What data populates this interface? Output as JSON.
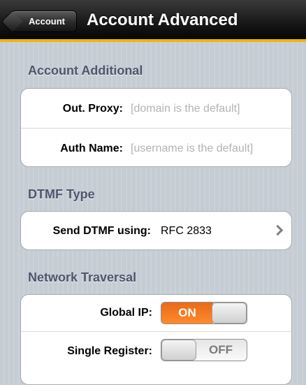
{
  "navbar": {
    "back_label": "Account",
    "title": "Account Advanced",
    "accent_color": "#f0b400"
  },
  "sections": {
    "account_additional": {
      "header": "Account Additional",
      "out_proxy": {
        "label": "Out. Proxy:",
        "placeholder": "[domain is the default]"
      },
      "auth_name": {
        "label": "Auth Name:",
        "placeholder": "[username is the default]"
      }
    },
    "dtmf_type": {
      "header": "DTMF Type",
      "send_dtmf": {
        "label": "Send DTMF using:",
        "value": "RFC 2833",
        "icon": "chevron-right-icon"
      }
    },
    "network_traversal": {
      "header": "Network Traversal",
      "global_ip": {
        "label": "Global IP:",
        "state": "ON",
        "on": true
      },
      "single_register": {
        "label": "Single Register:",
        "state": "OFF",
        "on": false
      }
    }
  },
  "colors": {
    "switch_on": "#ff7a1a",
    "section_header": "#4c566c"
  }
}
